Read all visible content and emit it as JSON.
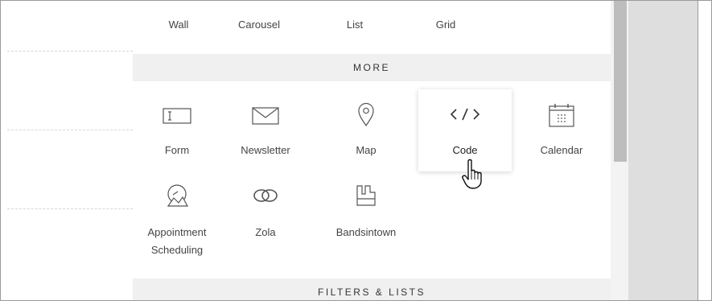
{
  "top_layouts": [
    "Wall",
    "Carousel",
    "List",
    "Grid"
  ],
  "more_section": {
    "title": "MORE",
    "blocks": [
      {
        "label": "Form",
        "icon": "form-icon"
      },
      {
        "label": "Newsletter",
        "icon": "envelope-icon"
      },
      {
        "label": "Map",
        "icon": "map-pin-icon"
      },
      {
        "label": "Code",
        "icon": "code-icon"
      },
      {
        "label": "Calendar",
        "icon": "calendar-icon"
      },
      {
        "label": "Appointment Scheduling",
        "label_line1": "Appointment",
        "label_line2": "Scheduling",
        "icon": "appointment-icon"
      },
      {
        "label": "Zola",
        "icon": "rings-icon"
      },
      {
        "label": "Bandsintown",
        "icon": "bandsintown-icon"
      }
    ]
  },
  "filters_section": {
    "title": "FILTERS & LISTS"
  },
  "cursor": {
    "icon": "hand-pointer-icon",
    "hovering": "Code"
  }
}
